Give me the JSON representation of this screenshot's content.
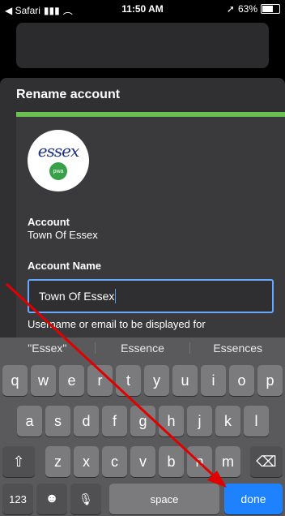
{
  "status_bar": {
    "back_app": "◀ Safari",
    "time": "11:50 AM",
    "battery": "63%"
  },
  "sheet": {
    "title": "Rename account"
  },
  "account": {
    "logo_text": "essex",
    "logo_badge": "pwa",
    "account_label": "Account",
    "account_value": "Town Of Essex",
    "name_label": "Account Name",
    "name_value": "Town Of Essex",
    "helper_text": "Username or email to be displayed for"
  },
  "suggestions": [
    "\"Essex\"",
    "Essence",
    "Essences"
  ],
  "keyboard": {
    "row1": [
      "q",
      "w",
      "e",
      "r",
      "t",
      "y",
      "u",
      "i",
      "o",
      "p"
    ],
    "row2": [
      "a",
      "s",
      "d",
      "f",
      "g",
      "h",
      "j",
      "k",
      "l"
    ],
    "row3": [
      "z",
      "x",
      "c",
      "v",
      "b",
      "n",
      "m"
    ],
    "shift_icon": "⇧",
    "backspace_icon": "⌫",
    "numbers_label": "123",
    "emoji_icon": "☻",
    "mic_icon": "🎙",
    "space_label": "space",
    "done_label": "done"
  },
  "colors": {
    "accent_green": "#6bc14f",
    "focus_blue": "#6aa7ff",
    "done_blue": "#1e82ff",
    "annotation_red": "#e00000"
  }
}
